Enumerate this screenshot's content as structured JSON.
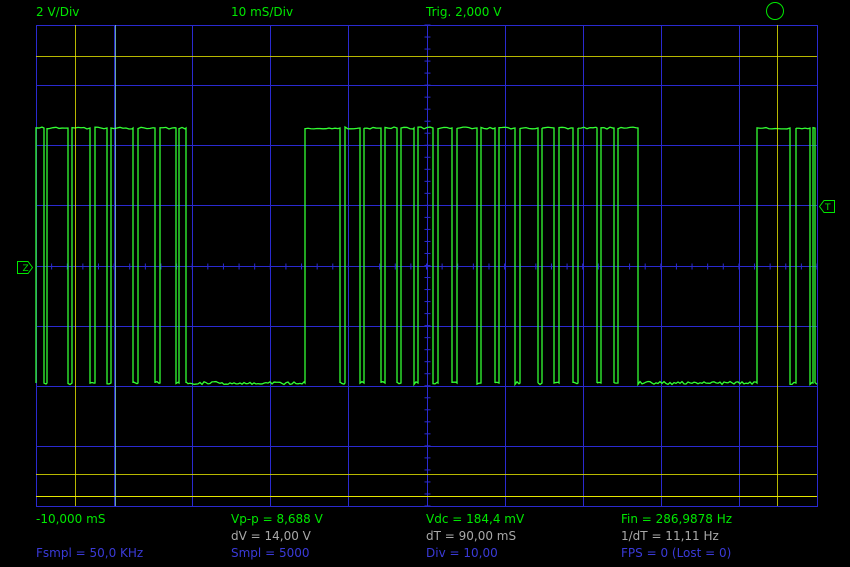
{
  "header": {
    "volts_div": "2 V/Div",
    "time_div": "10 mS/Div",
    "trigger": "Trig. 2,000 V"
  },
  "markers": {
    "zero_label": "Z",
    "trigger_label": "T"
  },
  "readouts": {
    "offset": "-10,000 mS",
    "vpp": "Vp-p = 8,688 V",
    "vdc": "Vdc = 184,4 mV",
    "fin": "Fin = 286,9878 Hz",
    "dv": "dV = 14,00 V",
    "dt": "dT = 90,00 mS",
    "inv_dt": "1/dT = 11,11 Hz",
    "fsmpl": "Fsmpl = 50,0 KHz",
    "smpl": "Smpl = 5000",
    "div": "Div = 10,00",
    "fps": "FPS = 0 (Lost = 0)"
  },
  "colors": {
    "grid": "#2a2ad0",
    "trace": "#33ff33",
    "cursor_yellow": "#e6e600",
    "cursor_cyan": "#7fd0d0",
    "text_green": "#00e800",
    "text_gray": "#a8a8a8",
    "text_blue": "#3a3ad8"
  },
  "trace_segments": [
    [
      0,
      1
    ],
    [
      8,
      2
    ],
    [
      19,
      4
    ],
    [
      36,
      6
    ],
    [
      53,
      7
    ],
    [
      64,
      3
    ],
    [
      69,
      2
    ],
    [
      81,
      3
    ],
    [
      91,
      8
    ],
    [
      94,
      5
    ],
    [
      142,
      4
    ]
  ]
}
